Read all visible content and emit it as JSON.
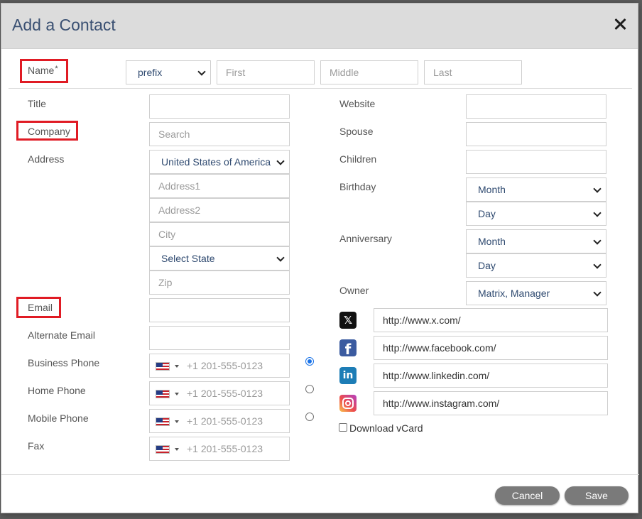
{
  "backdrop": {
    "text": "..."
  },
  "modal": {
    "title": "Add a Contact",
    "close_icon": "close-icon"
  },
  "name_row": {
    "label": "Name",
    "required_mark": "*",
    "prefix": "prefix",
    "first_placeholder": "First",
    "middle_placeholder": "Middle",
    "last_placeholder": "Last"
  },
  "left": {
    "title_label": "Title",
    "company_label": "Company",
    "company_placeholder": "Search",
    "address_label": "Address",
    "country": "United States of America",
    "address1_placeholder": "Address1",
    "address2_placeholder": "Address2",
    "city_placeholder": "City",
    "state": "Select State",
    "zip_placeholder": "Zip",
    "email_label": "Email",
    "alt_email_label": "Alternate Email",
    "business_phone_label": "Business Phone",
    "home_phone_label": "Home Phone",
    "mobile_phone_label": "Mobile Phone",
    "fax_label": "Fax",
    "phone_placeholder": "+1 201-555-0123",
    "primary_phone": "business"
  },
  "right": {
    "website_label": "Website",
    "spouse_label": "Spouse",
    "children_label": "Children",
    "birthday_label": "Birthday",
    "birthday_month": "Month",
    "birthday_day": "Day",
    "anniversary_label": "Anniversary",
    "anniversary_month": "Month",
    "anniversary_day": "Day",
    "owner_label": "Owner",
    "owner_value": "Matrix, Manager",
    "social": {
      "x": "http://www.x.com/",
      "facebook": "http://www.facebook.com/",
      "linkedin": "http://www.linkedin.com/",
      "instagram": "http://www.instagram.com/"
    },
    "download_vcard_label": "Download vCard",
    "download_vcard_checked": false
  },
  "footer": {
    "cancel_label": "Cancel",
    "save_label": "Save"
  },
  "colors": {
    "highlight": "#e01b24",
    "title": "#3a5072",
    "button": "#7a7a7a",
    "radio_selected": "#1a73e8"
  }
}
